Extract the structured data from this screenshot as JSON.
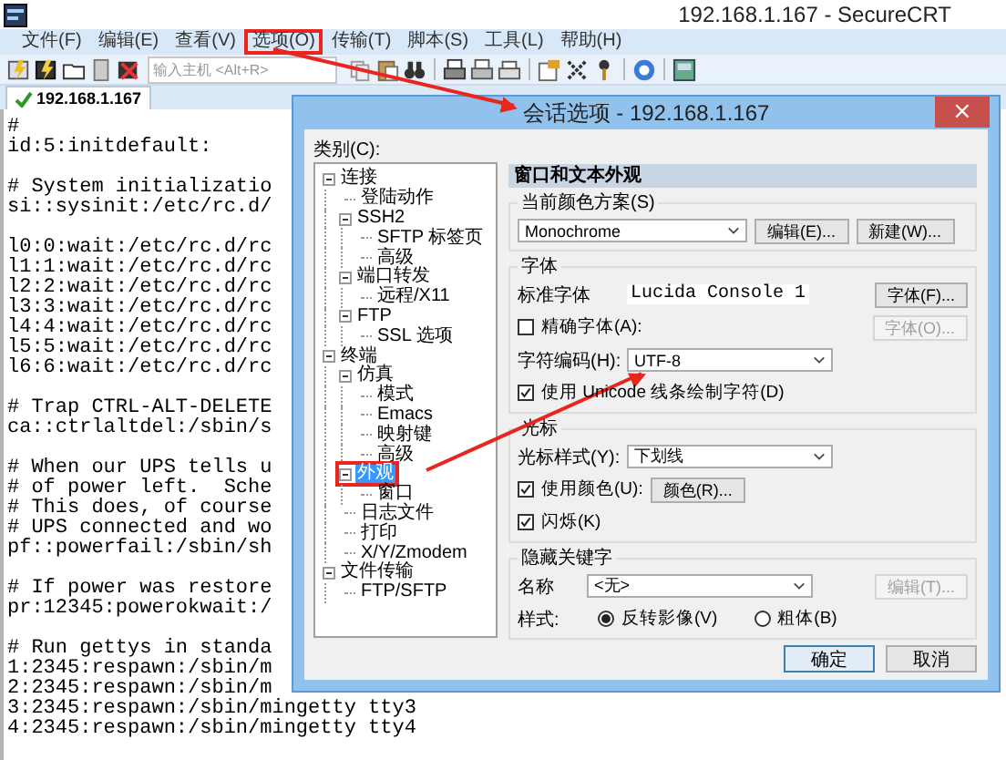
{
  "window": {
    "title": "192.168.1.167 - SecureCRT"
  },
  "menu": [
    {
      "label": "文件(F)",
      "highlighted": false
    },
    {
      "label": "编辑(E)",
      "highlighted": false
    },
    {
      "label": "查看(V)",
      "highlighted": false
    },
    {
      "label": "选项(O)",
      "highlighted": true
    },
    {
      "label": "传输(T)",
      "highlighted": false
    },
    {
      "label": "脚本(S)",
      "highlighted": false
    },
    {
      "label": "工具(L)",
      "highlighted": false
    },
    {
      "label": "帮助(H)",
      "highlighted": false
    }
  ],
  "toolbar": {
    "host_placeholder": "输入主机 <Alt+R>"
  },
  "tabs": [
    {
      "label": "192.168.1.167",
      "selected": true,
      "connected": true
    }
  ],
  "terminal": {
    "blocks": [
      {
        "kind": "block",
        "lines": [
          "#",
          "id:5:initdefault:"
        ]
      },
      {
        "kind": "block",
        "lines": [
          "# System initializatio",
          "si::sysinit:/etc/rc.d/"
        ]
      },
      {
        "kind": "block",
        "lines": [
          "l0:0:wait:/etc/rc.d/rc",
          "l1:1:wait:/etc/rc.d/rc",
          "l2:2:wait:/etc/rc.d/rc",
          "l3:3:wait:/etc/rc.d/rc",
          "l4:4:wait:/etc/rc.d/rc",
          "l5:5:wait:/etc/rc.d/rc",
          "l6:6:wait:/etc/rc.d/rc"
        ]
      },
      {
        "kind": "block",
        "lines": [
          "# Trap CTRL-ALT-DELETE",
          "ca::ctrlaltdel:/sbin/s"
        ]
      },
      {
        "kind": "block",
        "lines": [
          "# When our UPS tells u",
          "# of power left.  Sche",
          "# This does, of course",
          "# UPS connected and wo",
          "pf::powerfail:/sbin/sh"
        ]
      },
      {
        "kind": "block",
        "lines": [
          "# If power was restore",
          "pr:12345:powerokwait:/"
        ]
      },
      {
        "kind": "spaced_block",
        "lines": [
          "# Run gettys in standa",
          "1:2345:respawn:/sbin/m",
          "2:2345:respawn:/sbin/m",
          "3:2345:respawn:/sbin/mingetty tty3",
          "4:2345:respawn:/sbin/mingetty tty4"
        ]
      }
    ]
  },
  "dialog": {
    "title": "会话选项 - 192.168.1.167",
    "close": "×",
    "category_label": "类别(C):",
    "tree": [
      {
        "label": "连接",
        "expanded": true,
        "selected": false,
        "highlighted": false,
        "children": [
          {
            "label": "登陆动作",
            "selected": false,
            "highlighted": false
          },
          {
            "label": "SSH2",
            "expanded": true,
            "selected": false,
            "highlighted": false,
            "children": [
              {
                "label": "SFTP 标签页",
                "selected": false,
                "highlighted": false
              },
              {
                "label": "高级",
                "selected": false,
                "highlighted": false
              }
            ]
          },
          {
            "label": "端口转发",
            "expanded": true,
            "selected": false,
            "highlighted": false,
            "children": [
              {
                "label": "远程/X11",
                "selected": false,
                "highlighted": false
              }
            ]
          },
          {
            "label": "FTP",
            "expanded": true,
            "selected": false,
            "highlighted": false,
            "children": [
              {
                "label": "SSL 选项",
                "selected": false,
                "highlighted": false
              }
            ]
          }
        ]
      },
      {
        "label": "终端",
        "expanded": true,
        "selected": false,
        "highlighted": false,
        "children": [
          {
            "label": "仿真",
            "expanded": true,
            "selected": false,
            "highlighted": false,
            "children": [
              {
                "label": "模式",
                "selected": false,
                "highlighted": false
              },
              {
                "label": "Emacs",
                "selected": false,
                "highlighted": false
              },
              {
                "label": "映射键",
                "selected": false,
                "highlighted": false
              },
              {
                "label": "高级",
                "selected": false,
                "highlighted": false
              }
            ]
          },
          {
            "label": "外观",
            "expanded": true,
            "selected": true,
            "highlighted": true,
            "children": [
              {
                "label": "窗口",
                "selected": false,
                "highlighted": false
              }
            ]
          },
          {
            "label": "日志文件",
            "selected": false,
            "highlighted": false
          },
          {
            "label": "打印",
            "selected": false,
            "highlighted": false
          },
          {
            "label": "X/Y/Zmodem",
            "selected": false,
            "highlighted": false
          }
        ]
      },
      {
        "label": "文件传输",
        "expanded": true,
        "selected": false,
        "highlighted": false,
        "children": [
          {
            "label": "FTP/SFTP",
            "selected": false,
            "highlighted": false
          }
        ]
      }
    ],
    "panel": {
      "header": "窗口和文本外观",
      "scheme": {
        "legend": "当前颜色方案(S)",
        "value": "Monochrome",
        "buttons": [
          "编辑(E)...",
          "新建(W)..."
        ]
      },
      "font": {
        "legend": "字体",
        "standard_label": "标准字体",
        "standard_value": "Lucida Console 1",
        "font_button": "字体(F)...",
        "precise": {
          "label": "精确字体(A):",
          "checked": false
        },
        "precise_button": {
          "label": "字体(O)...",
          "disabled": true
        },
        "encoding_label": "字符编码(H):",
        "encoding_value": "UTF-8",
        "unicode": {
          "label": "使用 Unicode 线条绘制字符(D)",
          "checked": true
        }
      },
      "cursor": {
        "legend": "光标",
        "style_label": "光标样式(Y):",
        "style_value": "下划线",
        "use_color": {
          "label": "使用颜色(U):",
          "checked": true
        },
        "color_button": "颜色(R)...",
        "blink": {
          "label": "闪烁(K)",
          "checked": true
        }
      },
      "keywords": {
        "legend": "隐藏关键字",
        "name_label": "名称",
        "name_value": "<无>",
        "edit_button": {
          "label": "编辑(T)...",
          "disabled": true
        },
        "style_label": "样式:",
        "styles": [
          {
            "label": "反转影像(V)",
            "selected": true
          },
          {
            "label": "粗体(B)",
            "selected": false
          }
        ]
      }
    },
    "buttons": [
      {
        "label": "确定",
        "default": true
      },
      {
        "label": "取消",
        "default": false
      }
    ]
  }
}
